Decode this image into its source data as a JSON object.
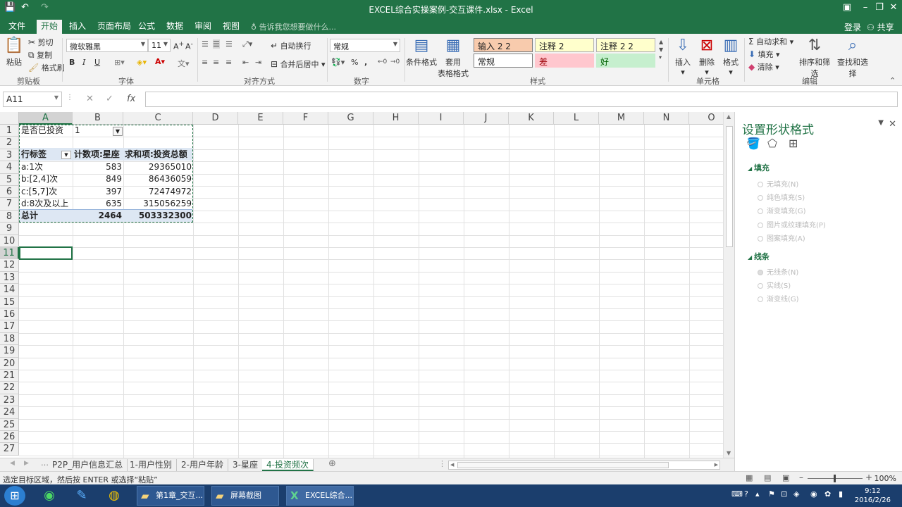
{
  "window": {
    "title": "EXCEL综合实操案例-交互课件.xlsx - Excel",
    "restore_icon": "ribbon-display-icon",
    "minimize": "–",
    "maximize": "❐",
    "close": "✕"
  },
  "quick_access": {
    "save": "💾",
    "undo": "↶",
    "redo": "↷"
  },
  "menu": {
    "tabs": [
      "文件",
      "开始",
      "插入",
      "页面布局",
      "公式",
      "数据",
      "审阅",
      "视图"
    ],
    "active_tab": "开始",
    "tell_me": "告诉我您想要做什么...",
    "sign_in": "登录",
    "share": "共享"
  },
  "ribbon": {
    "clipboard": {
      "paste": "粘贴",
      "cut": "剪切",
      "copy": "复制",
      "format_painter": "格式刷",
      "group": "剪贴板"
    },
    "font": {
      "name": "微软雅黑",
      "size": "11",
      "bold": "B",
      "italic": "I",
      "underline": "U",
      "group": "字体"
    },
    "alignment": {
      "wrap": "自动换行",
      "merge": "合并后居中",
      "group": "对齐方式"
    },
    "number": {
      "format": "常规",
      "percent": "%",
      "comma": ",",
      "group": "数字"
    },
    "styles": {
      "conditional": "条件格式",
      "table_format_1": "套用",
      "table_format_2": "表格格式",
      "boxes": [
        {
          "label": "输入 2 2",
          "bg": "#f8cbad",
          "border": "#7f7f7f"
        },
        {
          "label": "注释 2",
          "bg": "#ffffcc",
          "border": "#b2b2b2"
        },
        {
          "label": "注释 2 2",
          "bg": "#ffffcc",
          "border": "#b2b2b2"
        },
        {
          "label": "常规",
          "bg": "#ffffff",
          "border": "#7f7f7f"
        },
        {
          "label": "差",
          "bg": "#ffc7ce",
          "border": "#ffc7ce",
          "color": "#9c0006"
        },
        {
          "label": "好",
          "bg": "#c6efce",
          "border": "#c6efce",
          "color": "#006100"
        }
      ],
      "group": "样式"
    },
    "cells": {
      "insert": "插入",
      "delete": "删除",
      "format": "格式",
      "group": "单元格"
    },
    "editing": {
      "autosum": "自动求和",
      "fill": "填充",
      "clear": "清除",
      "sort": "排序和筛选",
      "find": "查找和选择",
      "group": "编辑"
    }
  },
  "formula_bar": {
    "name_box": "A11",
    "cancel": "✕",
    "enter": "✓",
    "fx": "fx",
    "content": ""
  },
  "grid": {
    "columns": [
      "A",
      "B",
      "C",
      "D",
      "E",
      "F",
      "G",
      "H",
      "I",
      "J",
      "K",
      "L",
      "M",
      "N",
      "O"
    ],
    "rows": [
      "1",
      "2",
      "3",
      "4",
      "5",
      "6",
      "7",
      "8",
      "9",
      "10",
      "11",
      "12",
      "13",
      "14",
      "15",
      "16",
      "17",
      "18",
      "19",
      "20",
      "21",
      "22",
      "23",
      "24",
      "25",
      "26",
      "27"
    ],
    "selected_column": "A",
    "selected_row": "11",
    "pivot": {
      "filter_label": "是否已投资",
      "filter_value": "1",
      "headers": [
        "行标签",
        "计数项:星座",
        "求和项:投资总额"
      ],
      "rows": [
        [
          "a:1次",
          "583",
          "29365010"
        ],
        [
          "b:[2,4]次",
          "849",
          "86436059"
        ],
        [
          "c:[5,7]次",
          "397",
          "72474972"
        ],
        [
          "d:8次及以上",
          "635",
          "315056259"
        ]
      ],
      "total": [
        "总计",
        "2464",
        "503332300"
      ]
    }
  },
  "task_pane": {
    "title": "设置形状格式",
    "fill_section": "填充",
    "fill_options": [
      "无填充(N)",
      "纯色填充(S)",
      "渐变填充(G)",
      "图片或纹理填充(P)",
      "图案填充(A)"
    ],
    "line_section": "线条",
    "line_options": [
      "无线条(N)",
      "实线(S)",
      "渐变线(G)"
    ]
  },
  "sheets": {
    "tabs": [
      "P2P_用户信息汇总",
      "1-用户性别",
      "2-用户年龄",
      "3-星座",
      "4-投资频次"
    ],
    "active": "4-投资频次"
  },
  "status": {
    "message": "选定目标区域，然后按 ENTER 或选择“粘贴”",
    "zoom": "100%"
  },
  "taskbar": {
    "tasks": [
      "第1章_交互...",
      "屏幕截图",
      "EXCEL综合..."
    ],
    "time": "9:12",
    "date": "2016/2/26"
  }
}
